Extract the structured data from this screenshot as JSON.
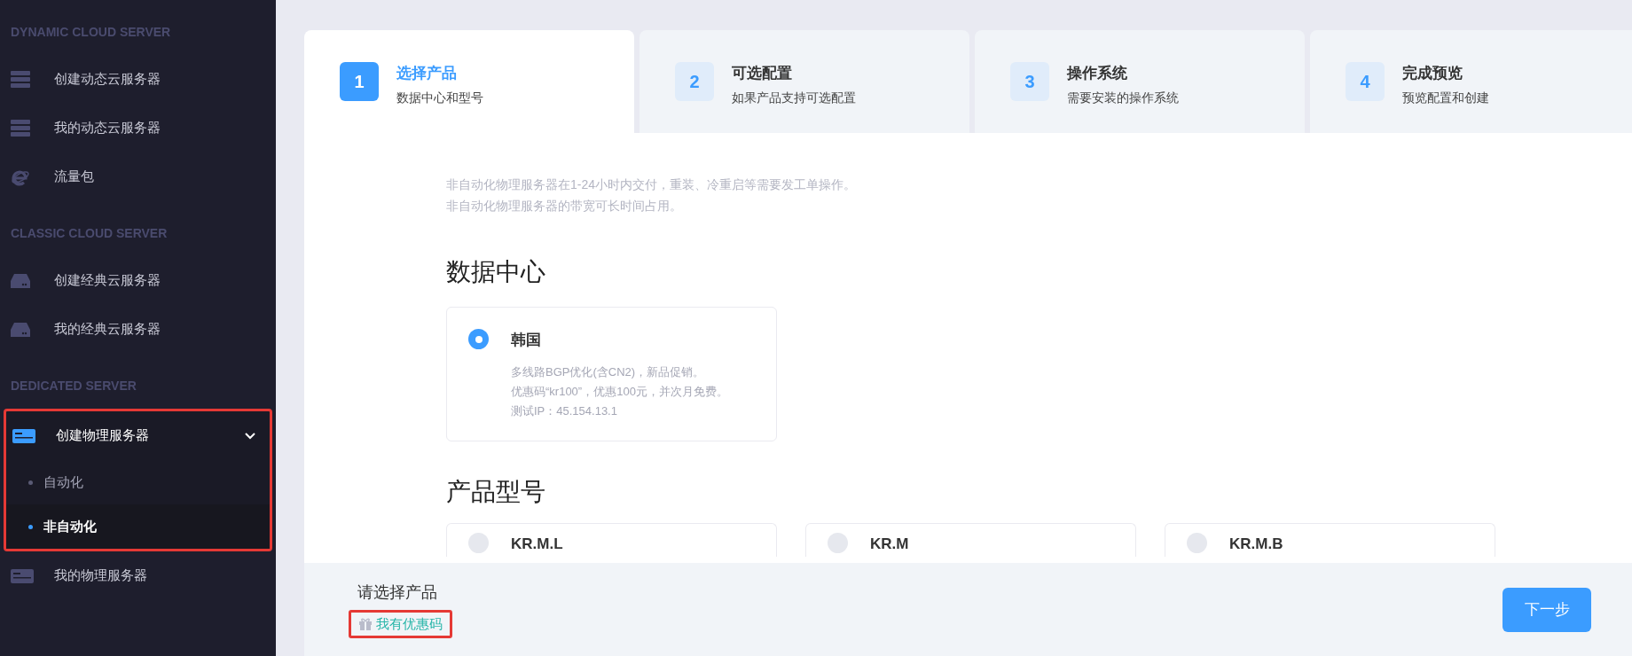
{
  "sidebar": {
    "sections": [
      {
        "title": "DYNAMIC CLOUD SERVER",
        "items": [
          {
            "label": "创建动态云服务器",
            "selected": false
          },
          {
            "label": "我的动态云服务器",
            "selected": false
          },
          {
            "label": "流量包",
            "selected": false
          }
        ]
      },
      {
        "title": "CLASSIC CLOUD SERVER",
        "items": [
          {
            "label": "创建经典云服务器",
            "selected": false
          },
          {
            "label": "我的经典云服务器",
            "selected": false
          }
        ]
      },
      {
        "title": "DEDICATED SERVER",
        "items": [
          {
            "label": "创建物理服务器",
            "selected": true,
            "expanded": true,
            "highlighted": true,
            "children": [
              {
                "label": "自动化",
                "selected": false
              },
              {
                "label": "非自动化",
                "selected": true
              }
            ]
          },
          {
            "label": "我的物理服务器",
            "selected": false
          }
        ]
      }
    ]
  },
  "steps": [
    {
      "number": "1",
      "title": "选择产品",
      "subtitle": "数据中心和型号",
      "selected": true
    },
    {
      "number": "2",
      "title": "可选配置",
      "subtitle": "如果产品支持可选配置",
      "selected": false
    },
    {
      "number": "3",
      "title": "操作系统",
      "subtitle": "需要安装的操作系统",
      "selected": false
    },
    {
      "number": "4",
      "title": "完成预览",
      "subtitle": "预览配置和创建",
      "selected": false
    }
  ],
  "notice": [
    "非自动化物理服务器在1-24小时内交付，重装、冷重启等需要发工单操作。",
    "非自动化物理服务器的带宽可长时间占用。"
  ],
  "datacenter": {
    "heading": "数据中心",
    "options": [
      {
        "name": "韩国",
        "selected": true,
        "lines": [
          "多线路BGP优化(含CN2)，新品促销。",
          "优惠码“kr100”，优惠100元，并次月免费。",
          "测试IP：45.154.13.1"
        ]
      }
    ]
  },
  "products": {
    "heading": "产品型号",
    "options": [
      {
        "name": "KR.M.L",
        "selected": false
      },
      {
        "name": "KR.M",
        "selected": false
      },
      {
        "name": "KR.M.B",
        "selected": false
      }
    ]
  },
  "footer": {
    "prompt": "请选择产品",
    "coupon_link": "我有优惠码",
    "coupon_highlighted": true,
    "next_button": "下一步"
  }
}
